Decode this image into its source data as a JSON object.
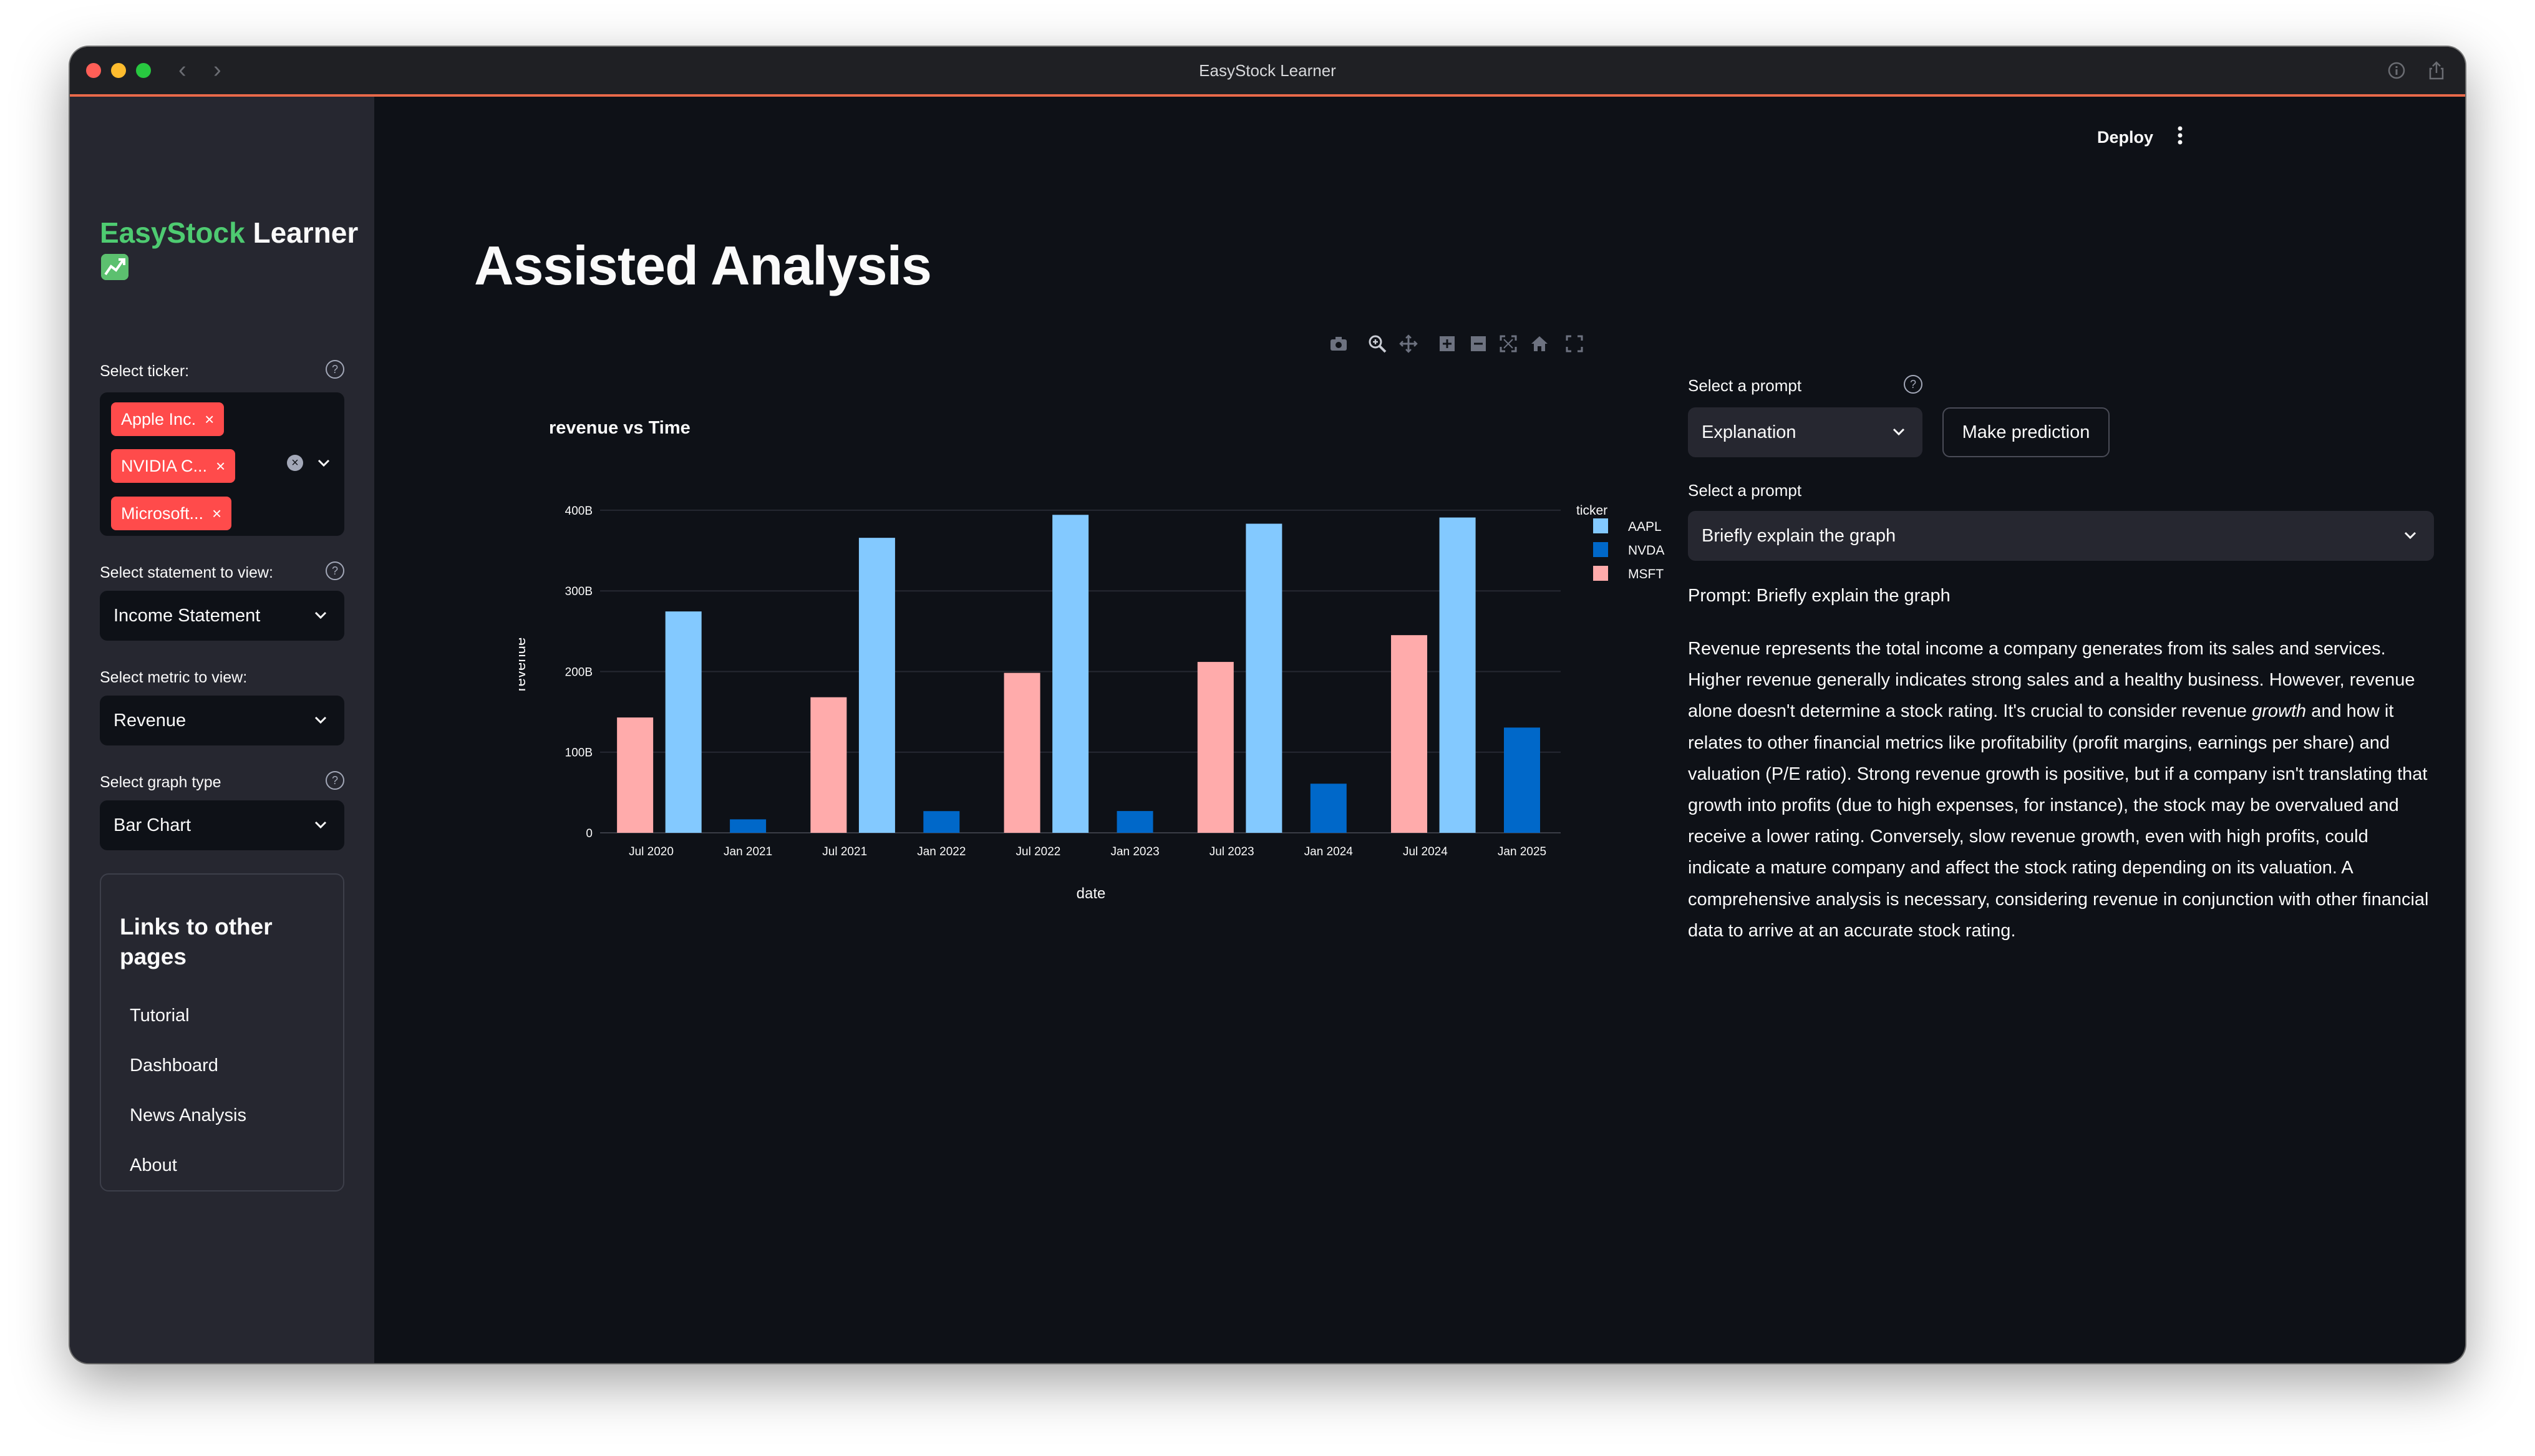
{
  "window": {
    "title": "EasyStock Learner"
  },
  "sidebar": {
    "brand_part1": "EasyStock",
    "brand_part2": "Learner",
    "ticker_label": "Select ticker:",
    "tickers": [
      "Apple Inc.",
      "NVIDIA C...",
      "Microsoft..."
    ],
    "statement_label": "Select statement to view:",
    "statement_value": "Income Statement",
    "metric_label": "Select metric to view:",
    "metric_value": "Revenue",
    "graph_label": "Select graph type",
    "graph_value": "Bar Chart",
    "links_title": "Links to other pages",
    "links": [
      "Tutorial",
      "Dashboard",
      "News Analysis",
      "About"
    ]
  },
  "header": {
    "deploy_label": "Deploy"
  },
  "main": {
    "title": "Assisted Analysis",
    "prompt_select_label": "Select a prompt",
    "prompt_type_value": "Explanation",
    "predict_button": "Make prediction",
    "prompt_select_label_2": "Select a prompt",
    "prompt_value": "Briefly explain the graph",
    "prompt_echo": "Prompt: Briefly explain the graph",
    "explanation_before": "Revenue represents the total income a company generates from its sales and services. Higher revenue generally indicates strong sales and a healthy business. However, revenue alone doesn't determine a stock rating. It's crucial to consider revenue ",
    "explanation_emphasis": "growth",
    "explanation_after": " and how it relates to other financial metrics like profitability (profit margins, earnings per share) and valuation (P/E ratio). Strong revenue growth is positive, but if a company isn't translating that growth into profits (due to high expenses, for instance), the stock may be overvalued and receive a lower rating. Conversely, slow revenue growth, even with high profits, could indicate a mature company and affect the stock rating depending on its valuation. A comprehensive analysis is necessary, considering revenue in conjunction with other financial data to arrive at an accurate stock rating."
  },
  "chart_data": {
    "type": "bar",
    "title": "revenue vs Time",
    "xlabel": "date",
    "ylabel": "revenue",
    "legend_title": "ticker",
    "legend_position": "top-right",
    "ylim": [
      0,
      410
    ],
    "y_ticks": [
      {
        "value": 0,
        "label": "0"
      },
      {
        "value": 100,
        "label": "100B"
      },
      {
        "value": 200,
        "label": "200B"
      },
      {
        "value": 300,
        "label": "300B"
      },
      {
        "value": 400,
        "label": "400B"
      }
    ],
    "x_ticks": [
      "Jul 2020",
      "Jan 2021",
      "Jul 2021",
      "Jan 2022",
      "Jul 2022",
      "Jan 2023",
      "Jul 2023",
      "Jan 2024",
      "Jul 2024",
      "Jan 2025"
    ],
    "series": [
      {
        "name": "AAPL",
        "color": "#83c9ff",
        "points": [
          {
            "date": "Sep 2020",
            "value": 274.5
          },
          {
            "date": "Sep 2021",
            "value": 365.8
          },
          {
            "date": "Sep 2022",
            "value": 394.3
          },
          {
            "date": "Sep 2023",
            "value": 383.3
          },
          {
            "date": "Sep 2024",
            "value": 391.0
          }
        ]
      },
      {
        "name": "NVDA",
        "color": "#0068c9",
        "points": [
          {
            "date": "Jan 2021",
            "value": 16.7
          },
          {
            "date": "Jan 2022",
            "value": 26.9
          },
          {
            "date": "Jan 2023",
            "value": 27.0
          },
          {
            "date": "Jan 2024",
            "value": 60.9
          },
          {
            "date": "Jan 2025",
            "value": 130.5
          }
        ]
      },
      {
        "name": "MSFT",
        "color": "#ffabab",
        "points": [
          {
            "date": "Jun 2020",
            "value": 143.0
          },
          {
            "date": "Jun 2021",
            "value": 168.1
          },
          {
            "date": "Jun 2022",
            "value": 198.3
          },
          {
            "date": "Jun 2023",
            "value": 211.9
          },
          {
            "date": "Jun 2024",
            "value": 245.1
          }
        ]
      }
    ]
  }
}
